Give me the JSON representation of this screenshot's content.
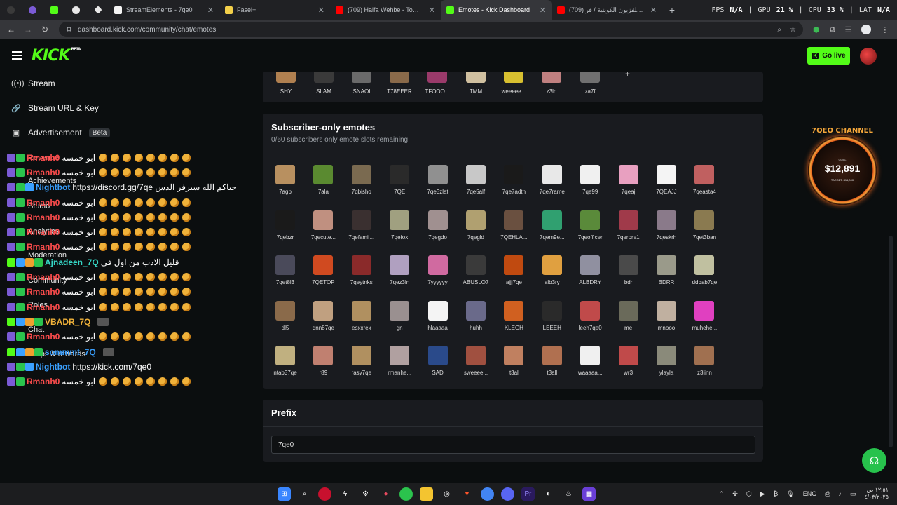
{
  "browser": {
    "tabs": [
      {
        "title": "StreamElements - 7qe0",
        "color": "#f4f4f4"
      },
      {
        "title": "Fasel+",
        "color": "#f3d04a"
      },
      {
        "title": "(709) Haifa Wehbe - Touta (Offi",
        "color": "#ff0000"
      },
      {
        "title": "Emotes - Kick Dashboard",
        "color": "#53fc18",
        "active": true
      },
      {
        "title": "(709) فرقة التلفزيون الكويتية / قر",
        "color": "#ff0000"
      }
    ],
    "url": "dashboard.kick.com/community/chat/emotes",
    "stats": {
      "fps_label": "FPS",
      "fps": "N/A",
      "gpu_label": "GPU",
      "gpu": "21 %",
      "cpu_label": "CPU",
      "cpu": "33 %",
      "lat_label": "LAT",
      "lat": "N/A"
    }
  },
  "header": {
    "logo": "KICK",
    "logo_badge": "BETA",
    "go_live": "Go live"
  },
  "sidebar": {
    "items": [
      {
        "label": "Stream",
        "icon": "broadcast-icon"
      },
      {
        "label": "Stream URL & Key",
        "icon": "link-icon"
      },
      {
        "label": "Advertisement",
        "icon": "ad-icon",
        "badge": "Beta"
      },
      {
        "label": "Revenue"
      },
      {
        "label": "Achievements"
      },
      {
        "label": "Studio"
      },
      {
        "label": "Analytics"
      },
      {
        "label": "Moderation"
      },
      {
        "label": "Community"
      },
      {
        "label": "Roles"
      },
      {
        "label": "Chat"
      },
      {
        "label": "Drops & rewards"
      }
    ]
  },
  "chat": {
    "messages": [
      {
        "user": "Rmanh0",
        "color": "#ff4d4d",
        "text": "ابو خمسه",
        "emotes": 8
      },
      {
        "user": "Rmanh0",
        "color": "#ff4d4d",
        "text": "ابو خمسه",
        "emotes": 8
      },
      {
        "user": "Nightbot",
        "color": "#3aa0ff",
        "text": "https://discord.gg/7qe حياكم الله سيرفر الدس",
        "emotes": 0
      },
      {
        "user": "Rmanh0",
        "color": "#ff4d4d",
        "text": "ابو خمسه",
        "emotes": 8
      },
      {
        "user": "Rmanh0",
        "color": "#ff4d4d",
        "text": "ابو خمسه",
        "emotes": 8
      },
      {
        "user": "Rmanh0",
        "color": "#ff4d4d",
        "text": "ابو خمسه",
        "emotes": 8
      },
      {
        "user": "Rmanh0",
        "color": "#ff4d4d",
        "text": "ابو خمسه",
        "emotes": 8
      },
      {
        "user": "Ajnadeen_7Q",
        "color": "#35d6c5",
        "text": "قليل الادب من اول في",
        "emotes": 0
      },
      {
        "user": "Rmanh0",
        "color": "#ff4d4d",
        "text": "ابو خمسه",
        "emotes": 8
      },
      {
        "user": "Rmanh0",
        "color": "#ff4d4d",
        "text": "ابو خمسه",
        "emotes": 8
      },
      {
        "user": "Rmanh0",
        "color": "#ff4d4d",
        "text": "ابو خمسه",
        "emotes": 8
      },
      {
        "user": "VBADR_7Q",
        "color": "#f0b23a",
        "text": "",
        "emotes": 0
      },
      {
        "user": "Rmanh0",
        "color": "#ff4d4d",
        "text": "ابو خمسه",
        "emotes": 8
      },
      {
        "user": "sommmt_7Q",
        "color": "#3aa0ff",
        "text": "",
        "emotes": 0
      },
      {
        "user": "Nightbot",
        "color": "#3aa0ff",
        "text": "https://kick.com/7qe0",
        "emotes": 0
      },
      {
        "user": "Rmanh0",
        "color": "#ff4d4d",
        "text": "ابو خمسه",
        "emotes": 8
      }
    ]
  },
  "top_emotes": [
    {
      "name": "SHY",
      "color": "#b08050"
    },
    {
      "name": "SLAM",
      "color": "#3a3a3a"
    },
    {
      "name": "SNAOI",
      "color": "#6a6a6a"
    },
    {
      "name": "T78EEER",
      "color": "#8a6a4a"
    },
    {
      "name": "TFOOO...",
      "color": "#9a3a6a"
    },
    {
      "name": "TMM",
      "color": "#d0c0a0"
    },
    {
      "name": "weeeee...",
      "color": "#d8c030"
    },
    {
      "name": "z3ln",
      "color": "#c08080"
    },
    {
      "name": "za7f",
      "color": "#707070"
    }
  ],
  "subscriber_section": {
    "title": "Subscriber-only emotes",
    "subtitle": "0/60 subscribers only emote slots remaining",
    "emotes": [
      {
        "name": "7agb",
        "color": "#b89060"
      },
      {
        "name": "7ala",
        "color": "#5a8a30"
      },
      {
        "name": "7qbisho",
        "color": "#7a6a50"
      },
      {
        "name": "7QE",
        "color": "#2a2a2a"
      },
      {
        "name": "7qe3zlat",
        "color": "#909090"
      },
      {
        "name": "7qe5alf",
        "color": "#c8c8c8"
      },
      {
        "name": "7qe7adth",
        "color": "#1a1a1a"
      },
      {
        "name": "7qe7rame",
        "color": "#e8e8e8"
      },
      {
        "name": "7qe99",
        "color": "#f0f0f0"
      },
      {
        "name": "7qeaj",
        "color": "#e8a0c0"
      },
      {
        "name": "7QEAJJ",
        "color": "#f4f4f4"
      },
      {
        "name": "7qeasta4",
        "color": "#c06060"
      },
      {
        "name": "7qebzr",
        "color": "#1a1a1a"
      },
      {
        "name": "7qecute...",
        "color": "#c09080"
      },
      {
        "name": "7qefamil...",
        "color": "#3a3030"
      },
      {
        "name": "7qefox",
        "color": "#a0a080"
      },
      {
        "name": "7qegdo",
        "color": "#a09090"
      },
      {
        "name": "7qegld",
        "color": "#b0a070"
      },
      {
        "name": "7QEHLA...",
        "color": "#6a5040"
      },
      {
        "name": "7qem9e...",
        "color": "#30a070"
      },
      {
        "name": "7qeofficer",
        "color": "#5a8a3a"
      },
      {
        "name": "7qerore1",
        "color": "#a03a4a"
      },
      {
        "name": "7qeskrh",
        "color": "#8a7a8a"
      },
      {
        "name": "7qet3ban",
        "color": "#8a7a50"
      },
      {
        "name": "7qet8l3",
        "color": "#4a4a5a"
      },
      {
        "name": "7QETOP",
        "color": "#d04a20"
      },
      {
        "name": "7qeytnks",
        "color": "#8a2a2a"
      },
      {
        "name": "7qez3ln",
        "color": "#b0a0c0"
      },
      {
        "name": "7yyyyyy",
        "color": "#d06aa0"
      },
      {
        "name": "ABUSLO7",
        "color": "#3a3a3a"
      },
      {
        "name": "ajjj7qe",
        "color": "#c04a10"
      },
      {
        "name": "alb3ry",
        "color": "#e0a040"
      },
      {
        "name": "ALBDRY",
        "color": "#9090a0"
      },
      {
        "name": "bdr",
        "color": "#4a4a4a"
      },
      {
        "name": "BDRR",
        "color": "#9a9a8a"
      },
      {
        "name": "ddbab7qe",
        "color": "#c0c0a0"
      },
      {
        "name": "dl5",
        "color": "#8a6a4a"
      },
      {
        "name": "dnn87qe",
        "color": "#c0a080"
      },
      {
        "name": "esxxrex",
        "color": "#b09060"
      },
      {
        "name": "gn",
        "color": "#9a9090"
      },
      {
        "name": "hlaaaaa",
        "color": "#f4f4f4"
      },
      {
        "name": "huhh",
        "color": "#6a6a8a"
      },
      {
        "name": "KLEGH",
        "color": "#d06020"
      },
      {
        "name": "LEEEH",
        "color": "#2a2a2a"
      },
      {
        "name": "leeh7qe0",
        "color": "#c04a4a"
      },
      {
        "name": "me",
        "color": "#6a6a5a"
      },
      {
        "name": "mnooo",
        "color": "#c0b0a0"
      },
      {
        "name": "muhehe...",
        "color": "#e040c0"
      },
      {
        "name": "ntab37qe",
        "color": "#c0b080"
      },
      {
        "name": "r89",
        "color": "#c08070"
      },
      {
        "name": "rasy7qe",
        "color": "#b09060"
      },
      {
        "name": "rmanhe...",
        "color": "#b0a0a0"
      },
      {
        "name": "SAD",
        "color": "#2a4a8a"
      },
      {
        "name": "sweeee...",
        "color": "#a05040"
      },
      {
        "name": "t3al",
        "color": "#c08060"
      },
      {
        "name": "t3all",
        "color": "#b07050"
      },
      {
        "name": "waaaaa...",
        "color": "#f0f0f0"
      },
      {
        "name": "wr3",
        "color": "#c04a4a"
      },
      {
        "name": "ylayla",
        "color": "#8a8a7a"
      },
      {
        "name": "z3linn",
        "color": "#a07050"
      }
    ]
  },
  "prefix": {
    "title": "Prefix",
    "value": "7qe0"
  },
  "widget": {
    "title": "7QEO CHANNEL",
    "goal_label": "GOAL",
    "amount": "$12,891",
    "target": "TARGET: $15,000"
  },
  "taskbar": {
    "lang": "ENG",
    "time": "١٢:٥١ ص",
    "date": "٤/٠٣/٢٠٢٥"
  }
}
